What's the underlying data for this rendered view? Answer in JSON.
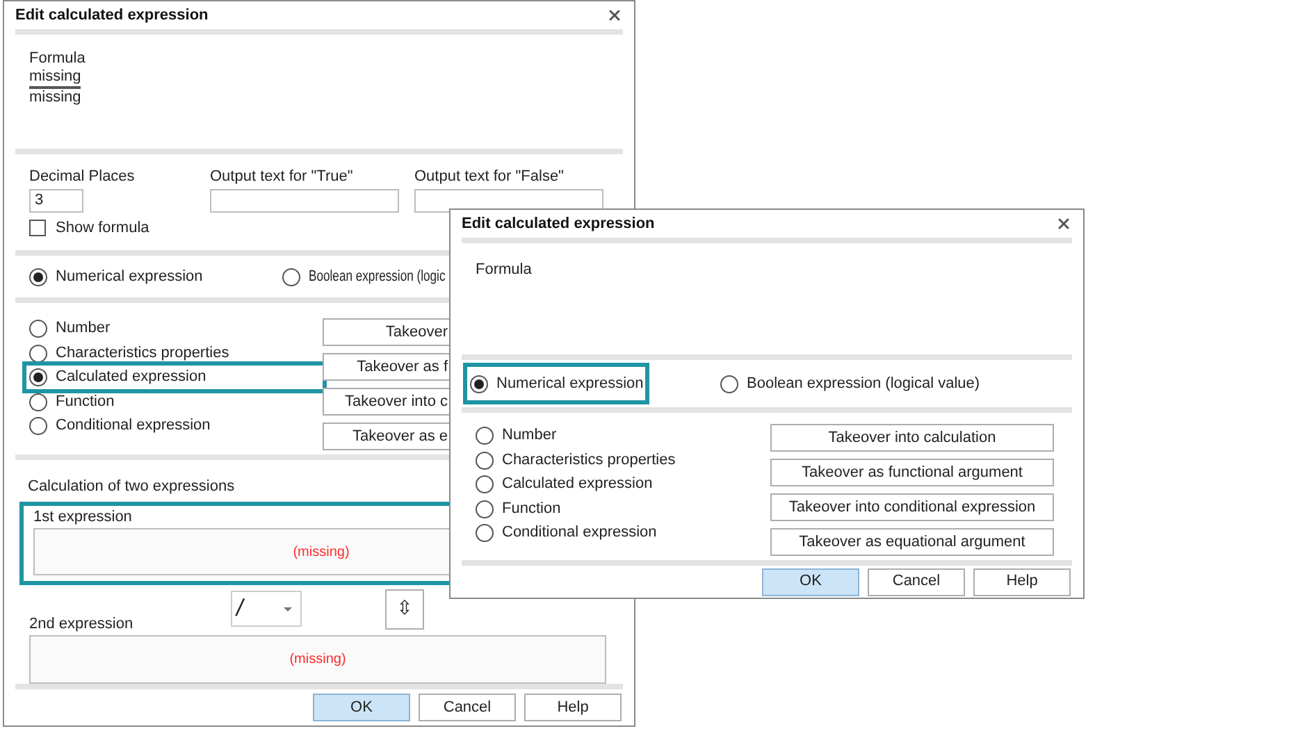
{
  "back_dialog": {
    "title": "Edit calculated expression",
    "formula": {
      "label": "Formula",
      "lines": [
        {
          "text": "missing",
          "underlined": true
        },
        {
          "text": "missing",
          "underlined": false
        }
      ]
    },
    "decimal_places": {
      "label": "Decimal Places",
      "value": "3"
    },
    "output_true": {
      "label": "Output text for \"True\""
    },
    "output_false": {
      "label": "Output text for \"False\""
    },
    "show_formula": {
      "label": "Show formula",
      "checked": false
    },
    "expression_types": [
      {
        "label": "Numerical expression",
        "selected": true,
        "highlighted": false
      },
      {
        "label": "Boolean expression (logic",
        "selected": false,
        "highlighted": false
      }
    ],
    "sources": [
      {
        "label": "Number",
        "selected": false,
        "highlighted": false
      },
      {
        "label": "Characteristics properties",
        "selected": false,
        "highlighted": false
      },
      {
        "label": "Calculated expression",
        "selected": true,
        "highlighted": true
      },
      {
        "label": "Function",
        "selected": false,
        "highlighted": false
      },
      {
        "label": "Conditional expression",
        "selected": false,
        "highlighted": false
      }
    ],
    "takeover_buttons": [
      "Takeover",
      "Takeover as f",
      "Takeover into c",
      "Takeover as e"
    ],
    "calculation": {
      "label": "Calculation of two expressions",
      "first": {
        "label": "1st expression",
        "value": "(missing)",
        "highlighted": true
      },
      "operator": "/",
      "swap": "⇳",
      "second": {
        "label": "2nd expression",
        "value": "(missing)",
        "highlighted": false
      }
    },
    "buttons": [
      {
        "label": "OK",
        "default": true
      },
      {
        "label": "Cancel",
        "default": false
      },
      {
        "label": "Help",
        "default": false
      }
    ]
  },
  "front_dialog": {
    "title": "Edit calculated expression",
    "formula": {
      "label": "Formula"
    },
    "expression_types": [
      {
        "label": "Numerical expression",
        "selected": true,
        "highlighted": true
      },
      {
        "label": "Boolean expression (logical value)",
        "selected": false,
        "highlighted": false
      }
    ],
    "sources": [
      {
        "label": "Number",
        "selected": false,
        "highlighted": false
      },
      {
        "label": "Characteristics properties",
        "selected": false,
        "highlighted": false
      },
      {
        "label": "Calculated expression",
        "selected": false,
        "highlighted": false
      },
      {
        "label": "Function",
        "selected": false,
        "highlighted": false
      },
      {
        "label": "Conditional expression",
        "selected": false,
        "highlighted": false
      }
    ],
    "takeover_buttons": [
      "Takeover into calculation",
      "Takeover as functional argument",
      "Takeover into conditional expression",
      "Takeover as equational argument"
    ],
    "buttons": [
      {
        "label": "OK",
        "default": true
      },
      {
        "label": "Cancel",
        "default": false
      },
      {
        "label": "Help",
        "default": false
      }
    ]
  }
}
